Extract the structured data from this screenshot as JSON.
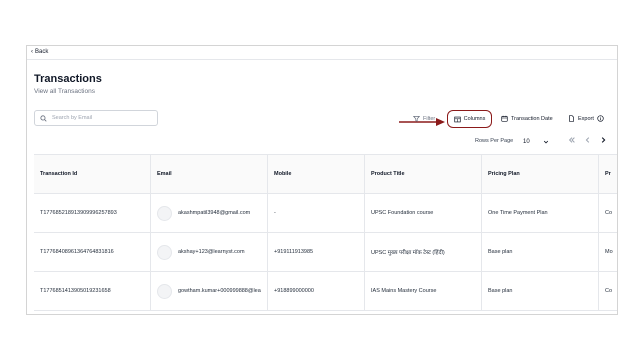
{
  "nav": {
    "back_label": "Back"
  },
  "page": {
    "title": "Transactions",
    "subtitle": "View all Transactions"
  },
  "search": {
    "placeholder": "Search by Email",
    "value": ""
  },
  "toolbar": {
    "filter_label": "Filter",
    "columns_label": "Columns",
    "date_label": "Transaction Date",
    "export_label": "Export"
  },
  "pagination": {
    "rows_per_page_label": "Rows Per Page",
    "rows_per_page_value": "10"
  },
  "table": {
    "columns": [
      "Transaction Id",
      "Email",
      "Mobile",
      "Product Title",
      "Pricing Plan",
      "Pr"
    ],
    "rows": [
      [
        "T17768521891390999625789​3",
        "akashmpatil3948@gmail.com",
        "-",
        "UPSC Foundation course",
        "One Time Payment Plan",
        "Co"
      ],
      [
        "T17768408961364764831816",
        "akshay+123@learnyst.com",
        "+919111913985",
        "UPSC मुख्य परीक्षा मॉक टेस्ट (हिंदी)",
        "Base plan",
        "Mo"
      ],
      [
        "T17768514139050192316​58",
        "gowtham.kumar+000999888@lea",
        "+918899000000",
        "IAS Mains Mastery Course",
        "Base plan",
        "Co"
      ]
    ]
  },
  "colors": {
    "accent": "#8b1a1a",
    "border": "#e5e7eb"
  }
}
